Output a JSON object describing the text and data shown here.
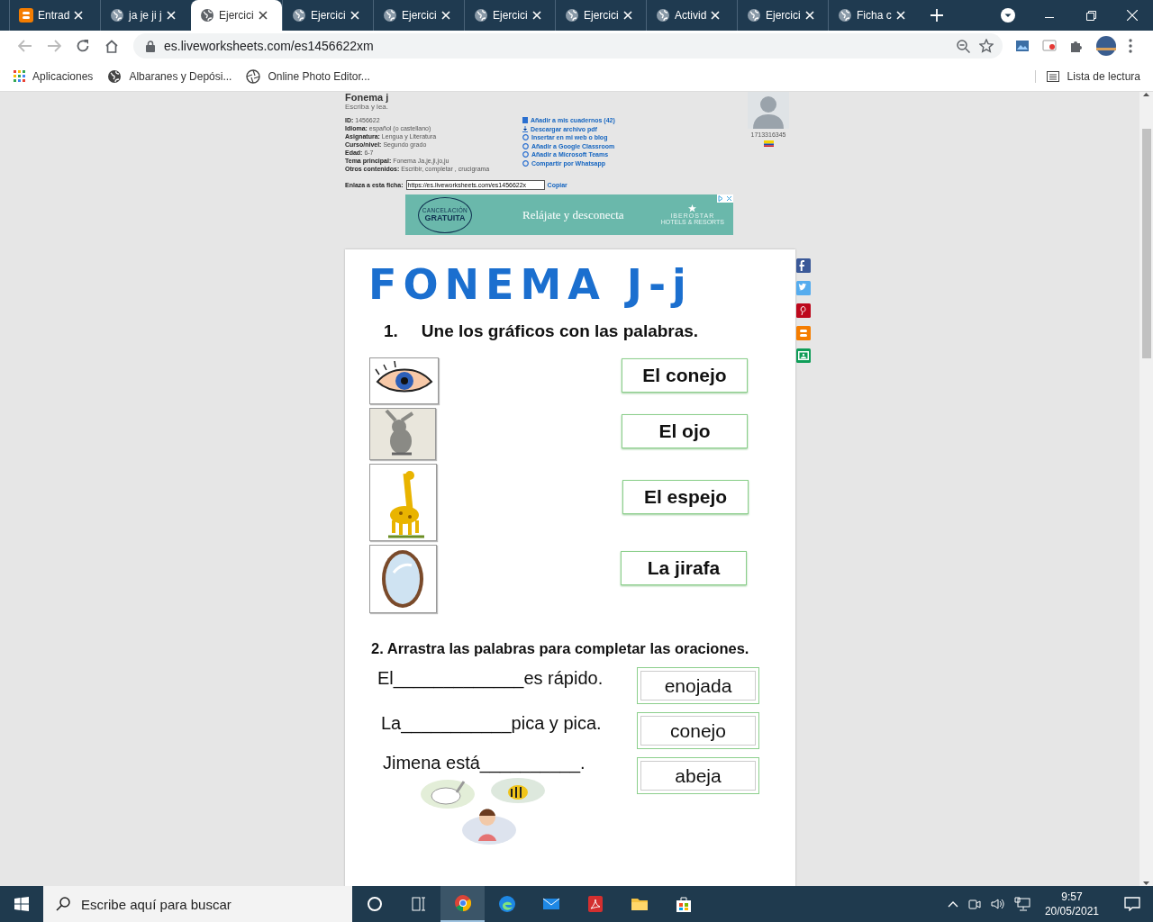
{
  "browser": {
    "tabs": [
      {
        "title": "Entrad",
        "kind": "blogger",
        "selected": false
      },
      {
        "title": "ja je ji j",
        "kind": "globe",
        "selected": false
      },
      {
        "title": "Ejercici",
        "kind": "globe",
        "selected": true
      },
      {
        "title": "Ejercici",
        "kind": "globe",
        "selected": false
      },
      {
        "title": "Ejercici",
        "kind": "globe",
        "selected": false
      },
      {
        "title": "Ejercici",
        "kind": "globe",
        "selected": false
      },
      {
        "title": "Ejercici",
        "kind": "globe",
        "selected": false
      },
      {
        "title": "Activid",
        "kind": "globe",
        "selected": false
      },
      {
        "title": "Ejercici",
        "kind": "globe",
        "selected": false
      },
      {
        "title": "Ficha c",
        "kind": "globe",
        "selected": false
      }
    ],
    "address": "es.liveworksheets.com/es1456622xm",
    "bookmarks": [
      {
        "label": "Aplicaciones",
        "kind": "apps"
      },
      {
        "label": "Albaranes y Depósi...",
        "kind": "globe"
      },
      {
        "label": "Online Photo Editor...",
        "kind": "aperture"
      }
    ],
    "reading_list": "Lista de lectura"
  },
  "page": {
    "title": "Fonema j",
    "subtitle": "Escriba y lea.",
    "info": [
      {
        "label": "ID:",
        "value": "1456622"
      },
      {
        "label": "Idioma:",
        "value": "español (o castellano)"
      },
      {
        "label": "Asignatura:",
        "value": "Lengua y Literatura"
      },
      {
        "label": "Curso/nivel:",
        "value": "Segundo grado"
      },
      {
        "label": "Edad:",
        "value": "6-7"
      },
      {
        "label": "Tema principal:",
        "value": "Fonema Ja,je,ji,jo,ju"
      },
      {
        "label": "Otros contenidos:",
        "value": "Escribir, completar , crucigrama"
      }
    ],
    "actions": [
      {
        "label": "Añadir a mis cuadernos (42)",
        "kind": "notebook"
      },
      {
        "label": "Descargar archivo pdf",
        "kind": "download"
      },
      {
        "label": "Insertar en mi web o blog",
        "kind": "circle"
      },
      {
        "label": "Añadir a Google Classroom",
        "kind": "circle"
      },
      {
        "label": "Añadir a Microsoft Teams",
        "kind": "circle"
      },
      {
        "label": "Compartir por Whatsapp",
        "kind": "circle"
      }
    ],
    "author_id": "1713316345",
    "link_label": "Enlaza a esta ficha:",
    "link_value": "https://es.liveworksheets.com/es1456622x",
    "copy": "Copiar",
    "ad": {
      "badge_top": "CANCELACIÓN",
      "badge_main": "GRATUITA",
      "text": "Relájate y desconecta",
      "brand": "IBEROSTAR",
      "brand_sub": "HOTELS & RESORTS"
    },
    "share": [
      {
        "kind": "facebook"
      },
      {
        "kind": "twitter"
      },
      {
        "kind": "pinterest"
      },
      {
        "kind": "blogger"
      },
      {
        "kind": "classroom"
      }
    ]
  },
  "worksheet": {
    "title": "FONEMA J-j",
    "exercise_1": {
      "number": "1.",
      "instruction": "Une los gráficos con las palabras.",
      "pictures": [
        {
          "kind": "eye"
        },
        {
          "kind": "rabbit"
        },
        {
          "kind": "giraffe"
        },
        {
          "kind": "mirror"
        }
      ],
      "words": [
        "El conejo",
        "El ojo",
        "El espejo",
        "La jirafa"
      ]
    },
    "exercise_2": {
      "instruction": "2. Arrastra las palabras para completar las oraciones.",
      "sentences": [
        {
          "before": "El",
          "blank": "_____________",
          "after": "es rápido.",
          "word": "enojada"
        },
        {
          "before": "La",
          "blank": "___________",
          "after": "pica y pica.",
          "word": "conejo"
        },
        {
          "before": "Jimena está",
          "blank": "__________",
          "after": ".",
          "word": "abeja"
        }
      ]
    }
  },
  "taskbar": {
    "search_placeholder": "Escribe aquí para buscar",
    "apps": [
      {
        "kind": "cortana",
        "active": false
      },
      {
        "kind": "taskview",
        "active": false
      },
      {
        "kind": "chrome",
        "active": true
      },
      {
        "kind": "edge",
        "active": false
      },
      {
        "kind": "mail",
        "active": false
      },
      {
        "kind": "acrobat",
        "active": false
      },
      {
        "kind": "files",
        "active": false
      },
      {
        "kind": "store",
        "active": false
      }
    ],
    "time": "9:57",
    "date": "20/05/2021"
  }
}
